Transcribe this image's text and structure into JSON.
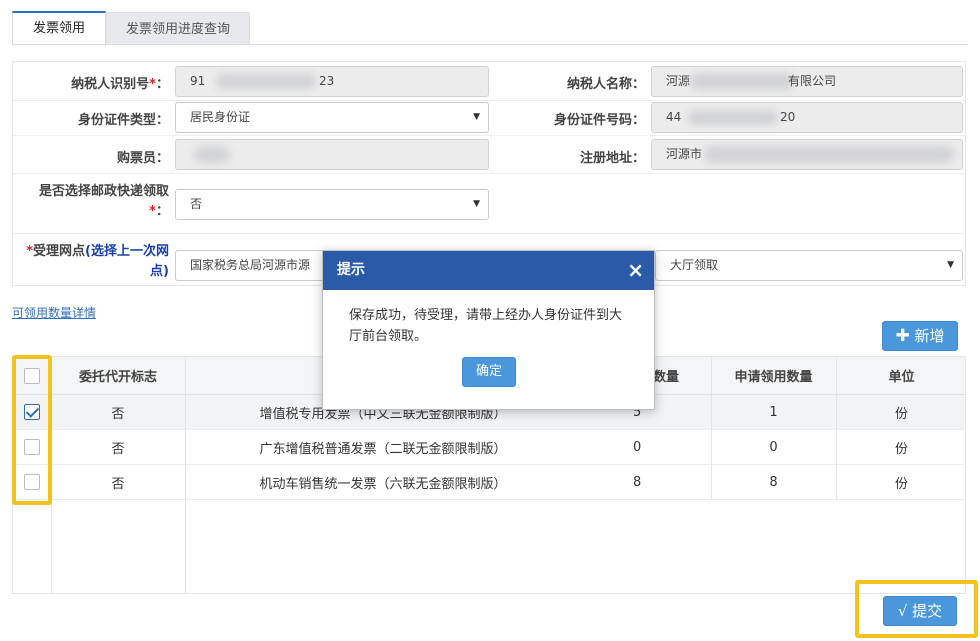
{
  "tabs": [
    {
      "label": "发票领用",
      "active": true
    },
    {
      "label": "发票领用进度查询",
      "active": false
    }
  ],
  "form": {
    "taxpayer_id": {
      "label": "纳税人识别号",
      "required_mark": "*",
      "colon": "：",
      "value_start": "91",
      "value_end": "23"
    },
    "taxpayer_name": {
      "label": "纳税人名称：",
      "value_start": "河源",
      "value_end": "有限公司"
    },
    "id_type": {
      "label": "身份证件类型：",
      "value": "居民身份证"
    },
    "id_number": {
      "label": "身份证件号码：",
      "value_start": "44",
      "value_end": "20"
    },
    "buyer": {
      "label": "购票员："
    },
    "reg_address": {
      "label": "注册地址：",
      "value_start": "河源市"
    },
    "express": {
      "label_line1": "是否选择邮政快递领取",
      "label_req": "*",
      "label_colon": "：",
      "value": "否"
    },
    "outlet": {
      "label_req": "*",
      "label_main": "受理网点",
      "label_paren": "(选择上一次网",
      "label_line2": "点)",
      "value": "国家税务总局河源市源"
    },
    "pickup": {
      "value": "大厅领取"
    }
  },
  "links": {
    "quantity_detail": "可领用数量详情"
  },
  "buttons": {
    "add": "新增",
    "add_icon": "plus-icon",
    "submit": "√ 提交",
    "ok": "确定"
  },
  "table": {
    "headers": [
      "委托代开标志",
      "数量",
      "申请领用数量",
      "单位"
    ],
    "rows": [
      {
        "checked": true,
        "flag": "否",
        "name": "增值税专用发票（中文三联无金额限制版）",
        "qty": "5",
        "apply": "1",
        "unit": "份"
      },
      {
        "checked": false,
        "flag": "否",
        "name": "广东增值税普通发票（二联无金额限制版）",
        "qty": "0",
        "apply": "0",
        "unit": "份"
      },
      {
        "checked": false,
        "flag": "否",
        "name": "机动车销售统一发票（六联无金额限制版）",
        "qty": "8",
        "apply": "8",
        "unit": "份"
      }
    ]
  },
  "modal": {
    "title": "提示",
    "close": "×",
    "message": "保存成功，待受理，请带上经办人身份证件到大厅前台领取。"
  },
  "colors": {
    "accent": "#2b5ba8",
    "button": "#4a97dc",
    "highlight": "#f4c21c",
    "required": "#e02020"
  }
}
